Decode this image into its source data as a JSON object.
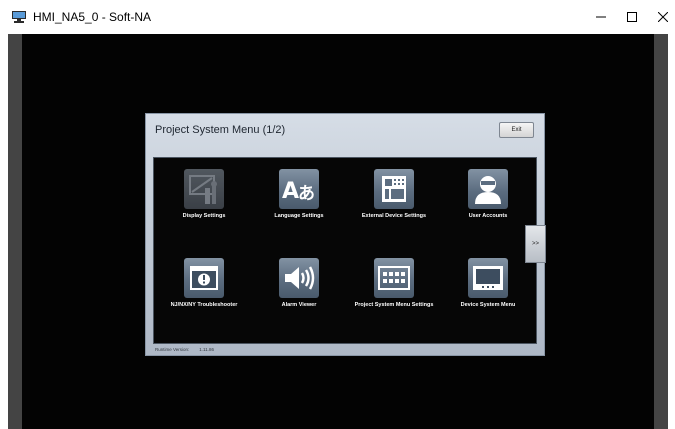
{
  "window": {
    "title": "HMI_NA5_0 - Soft-NA"
  },
  "menu": {
    "title": "Project System Menu (1/2)",
    "exit_label": "Exit",
    "next_label": ">>",
    "runtime_label": "Runtime Version:",
    "runtime_version": "1.11.86",
    "items": [
      {
        "label": "Display Settings",
        "icon": "display-settings-icon",
        "enabled": false
      },
      {
        "label": "Language Settings",
        "icon": "language-icon",
        "enabled": true
      },
      {
        "label": "External Device Settings",
        "icon": "external-device-icon",
        "enabled": true
      },
      {
        "label": "User Accounts",
        "icon": "user-icon",
        "enabled": true
      },
      {
        "label": "NJ/NX/NY Troubleshooter",
        "icon": "troubleshooter-icon",
        "enabled": true
      },
      {
        "label": "Alarm Viewer",
        "icon": "speaker-icon",
        "enabled": true
      },
      {
        "label": "Project System Menu Settings",
        "icon": "keypad-icon",
        "enabled": true
      },
      {
        "label": "Device System Menu",
        "icon": "device-monitor-icon",
        "enabled": true
      }
    ]
  },
  "colors": {
    "screen_bg": "#030303",
    "panel_bg": "#c4cdd8",
    "tile_icon": "#5c6d80"
  }
}
